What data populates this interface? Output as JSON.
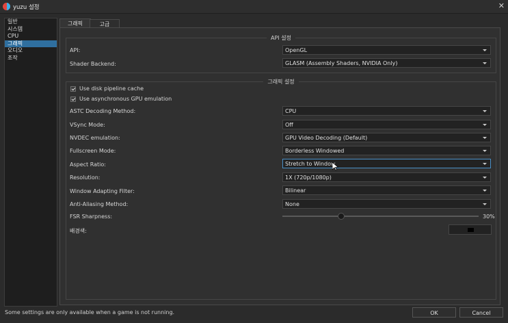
{
  "window": {
    "title": "yuzu 설정"
  },
  "sidebar": {
    "items": [
      {
        "label": "일반"
      },
      {
        "label": "시스템"
      },
      {
        "label": "CPU"
      },
      {
        "label": "그래픽"
      },
      {
        "label": "오디오"
      },
      {
        "label": "조작"
      }
    ],
    "selected_index": 3
  },
  "tabs": [
    {
      "label": "그래픽"
    },
    {
      "label": "고급"
    }
  ],
  "api_group": {
    "title": "API 설정",
    "api": {
      "label": "API:",
      "value": "OpenGL"
    },
    "shader": {
      "label": "Shader Backend:",
      "value": "GLASM (Assembly Shaders, NVIDIA Only)"
    }
  },
  "graphics_group": {
    "title": "그래픽 설정",
    "disk_cache": {
      "label": "Use disk pipeline cache",
      "checked": true
    },
    "async_gpu": {
      "label": "Use asynchronous GPU emulation",
      "checked": true
    },
    "astc": {
      "label": "ASTC Decoding Method:",
      "value": "CPU"
    },
    "vsync": {
      "label": "VSync Mode:",
      "value": "Off"
    },
    "nvdec": {
      "label": "NVDEC emulation:",
      "value": "GPU Video Decoding (Default)"
    },
    "fullscreen": {
      "label": "Fullscreen Mode:",
      "value": "Borderless Windowed"
    },
    "aspect": {
      "label": "Aspect Ratio:",
      "value": "Stretch to Window"
    },
    "resolution": {
      "label": "Resolution:",
      "value": "1X (720p/1080p)"
    },
    "filter": {
      "label": "Window Adapting Filter:",
      "value": "Bilinear"
    },
    "antialias": {
      "label": "Anti-Aliasing Method:",
      "value": "None"
    },
    "fsr": {
      "label": "FSR Sharpness:",
      "value": "30%",
      "level": 0.3
    },
    "bgcolor": {
      "label": "배경색:",
      "color": "#000000"
    }
  },
  "footer": {
    "note": "Some settings are only available when a game is not running.",
    "ok_label": "OK",
    "cancel_label": "Cancel"
  },
  "icons": {
    "close": "close-icon",
    "app": "yuzu-logo-icon"
  }
}
